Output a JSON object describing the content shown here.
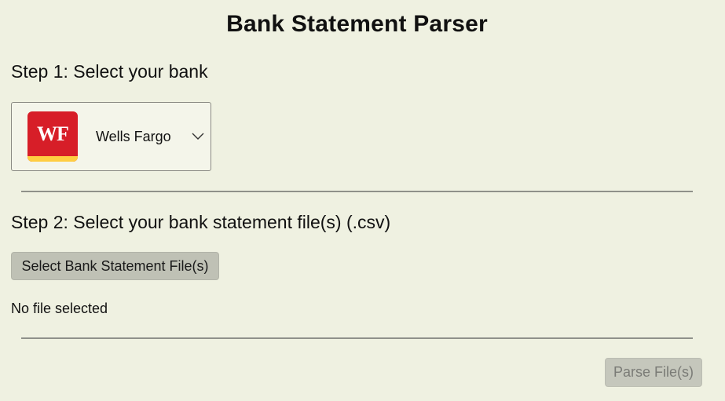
{
  "page": {
    "title": "Bank Statement Parser"
  },
  "step1": {
    "label": "Step 1: Select your bank",
    "bank_select": {
      "selected_bank": "Wells Fargo",
      "logo_text": "WF",
      "logo_colors": {
        "background": "#d71e28",
        "stripe": "#ffcd41",
        "text": "#ffffff"
      },
      "dropdown_icon": "chevron-down-icon"
    }
  },
  "step2": {
    "label": "Step 2: Select your bank statement file(s) (.csv)",
    "select_button_label": "Select Bank Statement File(s)",
    "file_status": "No file selected"
  },
  "actions": {
    "parse_button_label": "Parse File(s)",
    "parse_button_disabled": true
  },
  "colors": {
    "page_background": "#eff1e1",
    "button_background": "#bfc1b5",
    "disabled_text": "#7a7b76"
  }
}
